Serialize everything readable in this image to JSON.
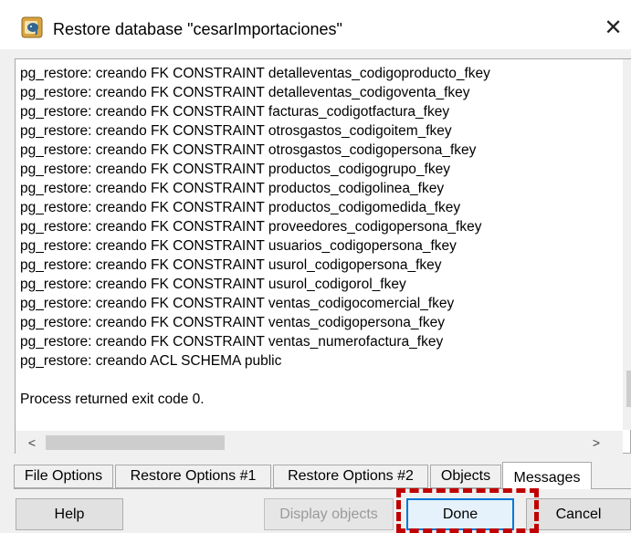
{
  "window": {
    "title": "Restore database \"cesarImportaciones\"",
    "app_icon": "pgadmin-elephant-icon",
    "close_glyph": "✕"
  },
  "log": {
    "lines": [
      "pg_restore: creando FK CONSTRAINT detalleventas_codigoproducto_fkey",
      "pg_restore: creando FK CONSTRAINT detalleventas_codigoventa_fkey",
      "pg_restore: creando FK CONSTRAINT facturas_codigotfactura_fkey",
      "pg_restore: creando FK CONSTRAINT otrosgastos_codigoitem_fkey",
      "pg_restore: creando FK CONSTRAINT otrosgastos_codigopersona_fkey",
      "pg_restore: creando FK CONSTRAINT productos_codigogrupo_fkey",
      "pg_restore: creando FK CONSTRAINT productos_codigolinea_fkey",
      "pg_restore: creando FK CONSTRAINT productos_codigomedida_fkey",
      "pg_restore: creando FK CONSTRAINT proveedores_codigopersona_fkey",
      "pg_restore: creando FK CONSTRAINT usuarios_codigopersona_fkey",
      "pg_restore: creando FK CONSTRAINT usurol_codigopersona_fkey",
      "pg_restore: creando FK CONSTRAINT usurol_codigorol_fkey",
      "pg_restore: creando FK CONSTRAINT ventas_codigocomercial_fkey",
      "pg_restore: creando FK CONSTRAINT ventas_codigopersona_fkey",
      "pg_restore: creando FK CONSTRAINT ventas_numerofactura_fkey",
      "pg_restore: creando ACL SCHEMA public"
    ],
    "exit_message": "Process returned exit code 0."
  },
  "scrollbars": {
    "up_glyph": "⌃",
    "down_glyph": "⌄",
    "left_glyph": "<",
    "right_glyph": ">"
  },
  "tabs": [
    {
      "label": "File Options"
    },
    {
      "label": "Restore Options #1"
    },
    {
      "label": "Restore Options #2"
    },
    {
      "label": "Objects"
    },
    {
      "label": "Messages",
      "active": true
    }
  ],
  "buttons": {
    "help": "Help",
    "display_objects": "Display objects",
    "done": "Done",
    "cancel": "Cancel"
  },
  "colors": {
    "highlight": "#c00000",
    "focus": "#0078d7"
  }
}
